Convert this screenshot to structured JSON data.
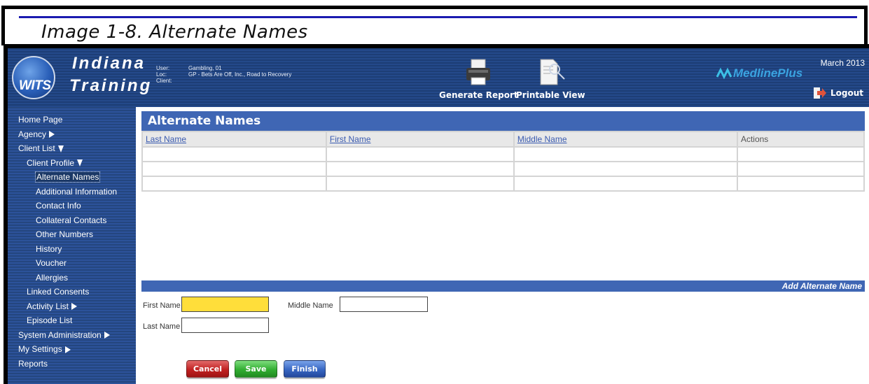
{
  "caption": "Image 1-8. Alternate Names",
  "header": {
    "brand_line1": "Indiana",
    "brand_line2": "Training",
    "logo_text": "WITS",
    "context": {
      "user_label": "User:",
      "user_value": "Gambling, 01",
      "loc_label": "Loc:",
      "loc_value": "GP - Bets Are Off, Inc., Road to Recovery",
      "client_label": "Client:",
      "client_value": ""
    },
    "generate_report": "Generate Report",
    "printable_view": "Printable View",
    "medline": "MedlinePlus",
    "date": "March 2013",
    "logout": "Logout"
  },
  "sidebar": {
    "items": [
      {
        "label": "Home Page"
      },
      {
        "label": "Agency"
      },
      {
        "label": "Client List"
      },
      {
        "label": "Client Profile"
      },
      {
        "label": "Alternate Names"
      },
      {
        "label": "Additional Information"
      },
      {
        "label": "Contact Info"
      },
      {
        "label": "Collateral Contacts"
      },
      {
        "label": "Other Numbers"
      },
      {
        "label": "History"
      },
      {
        "label": "Voucher"
      },
      {
        "label": "Allergies"
      },
      {
        "label": "Linked Consents"
      },
      {
        "label": "Activity List"
      },
      {
        "label": "Episode List"
      },
      {
        "label": "System Administration"
      },
      {
        "label": "My Settings"
      },
      {
        "label": "Reports"
      }
    ]
  },
  "main": {
    "title": "Alternate Names",
    "columns": [
      "Last Name",
      "First Name",
      "Middle Name",
      "Actions"
    ],
    "add_link": "Add Alternate Name",
    "form": {
      "first_name_label": "First Name",
      "middle_name_label": "Middle Name",
      "last_name_label": "Last Name",
      "first_name_value": "",
      "middle_name_value": "",
      "last_name_value": ""
    },
    "buttons": {
      "cancel": "Cancel",
      "save": "Save",
      "finish": "Finish"
    }
  },
  "colors": {
    "header_blue": "#1d3e76",
    "section_blue": "#3f66b4",
    "focus_yellow": "#ffde3a",
    "cancel_red": "#c12121",
    "save_green": "#31ad31",
    "finish_blue": "#3766c2"
  }
}
